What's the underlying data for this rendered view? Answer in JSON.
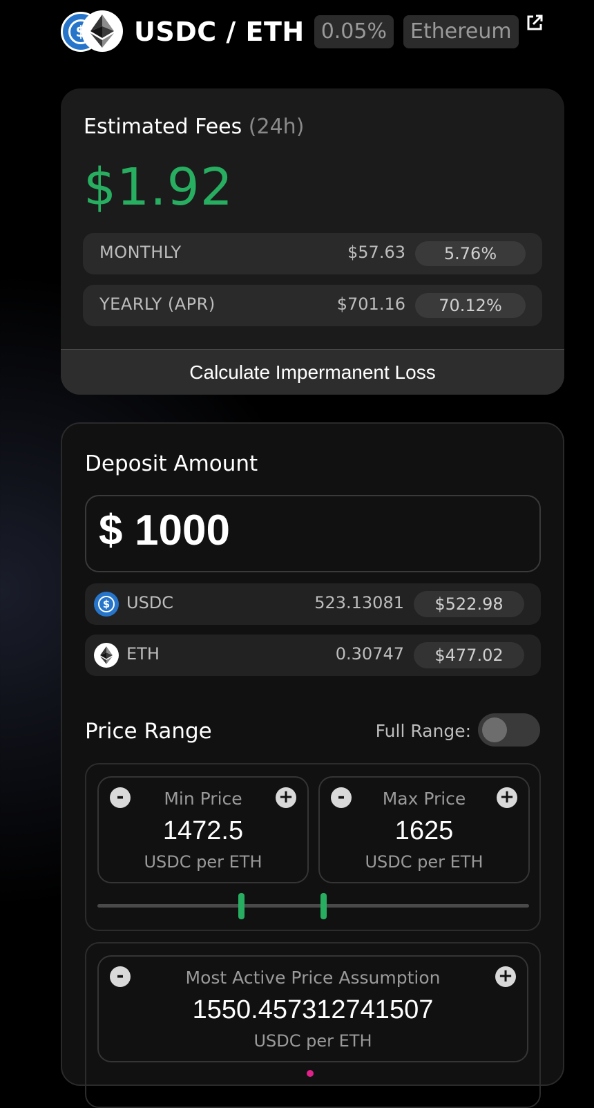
{
  "header": {
    "pair": "USDC / ETH",
    "fee_tier": "0.05%",
    "network": "Ethereum",
    "icons": [
      "usdc-icon",
      "eth-icon",
      "external-link-icon"
    ]
  },
  "fees": {
    "title": "Estimated Fees",
    "period": "(24h)",
    "value": "$1.92",
    "rows": [
      {
        "label": "MONTHLY",
        "amount": "$57.63",
        "percent": "5.76%"
      },
      {
        "label": "YEARLY (APR)",
        "amount": "$701.16",
        "percent": "70.12%"
      }
    ],
    "calc_button": "Calculate Impermanent Loss"
  },
  "deposit": {
    "title": "Deposit Amount",
    "currency": "$",
    "amount": "1000",
    "tokens": [
      {
        "symbol": "USDC",
        "qty": "523.13081",
        "usd": "$522.98",
        "icon": "usdc-icon"
      },
      {
        "symbol": "ETH",
        "qty": "0.30747",
        "usd": "$477.02",
        "icon": "eth-icon"
      }
    ]
  },
  "price_range": {
    "title": "Price Range",
    "full_range_label": "Full Range:",
    "full_range_on": false,
    "min": {
      "label": "Min Price",
      "value": "1472.5",
      "unit": "USDC per ETH"
    },
    "max": {
      "label": "Max Price",
      "value": "1625",
      "unit": "USDC per ETH"
    },
    "minus": "-",
    "plus": "+"
  },
  "active_price": {
    "label": "Most Active Price Assumption",
    "value": "1550.457312741507",
    "unit": "USDC per ETH"
  },
  "colors": {
    "accent_green": "#27ae60",
    "usdc_blue": "#2775ca",
    "marker_pink": "#e0218a"
  }
}
